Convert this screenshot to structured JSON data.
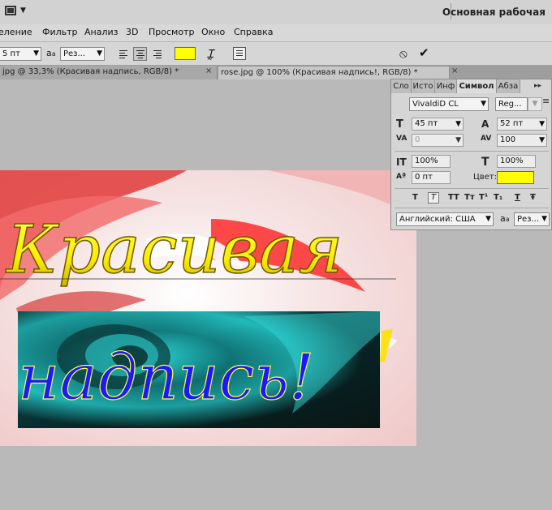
{
  "titlebar": {
    "workspace": "Основная рабочая"
  },
  "menu": [
    "еление",
    "Фильтр",
    "Анализ",
    "3D",
    "Просмотр",
    "Окно",
    "Справка"
  ],
  "options": {
    "size": "5 пт",
    "aa_label": "a",
    "aa_sub": "a",
    "aa_value": "Рез...",
    "color_swatch": "#ffff00"
  },
  "tabs": {
    "first": "jpg @ 33,3% (Красивая надпись, RGB/8) *",
    "second": "rose.jpg @ 100% (Красивая надпись!, RGB/8) *"
  },
  "artwork": {
    "line1": "Красивая",
    "line2": "надпись!"
  },
  "panel": {
    "tabs": [
      "Сло",
      "Исто",
      "Инф",
      "Символ",
      "Абза"
    ],
    "font_family": "VivaldiD CL",
    "font_style": "Reg...",
    "size": "45 пт",
    "leading": "52 пт",
    "kerning": "0",
    "tracking": "100",
    "vscale": "100%",
    "hscale": "100%",
    "baseline": "0 пт",
    "color_label": "Цвет:",
    "color_value": "#ffff00",
    "style_buttons": [
      "T",
      "T",
      "TT",
      "Tт",
      "T¹",
      "T₁",
      "T",
      "Ŧ"
    ],
    "language": "Английский: США",
    "aa_label": "a",
    "aa_sub": "a",
    "aa_value": "Рез..."
  }
}
